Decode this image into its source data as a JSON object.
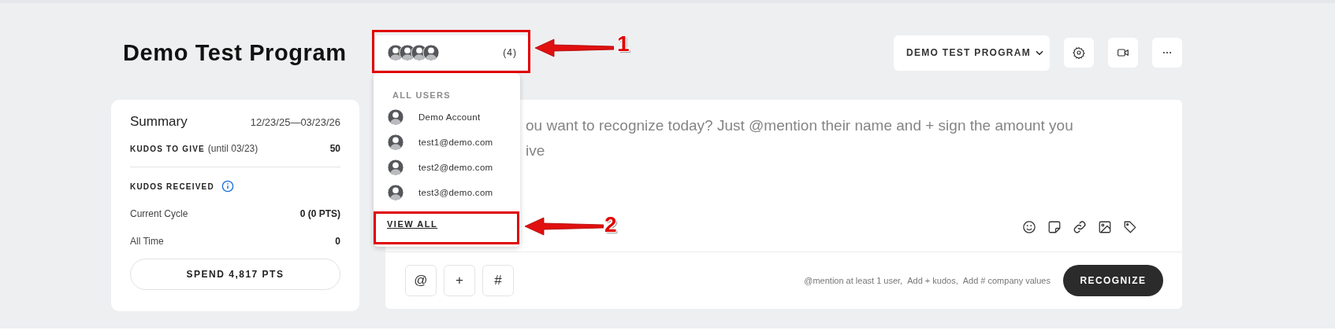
{
  "page_title": "Demo Test Program",
  "members_button": {
    "count": "(4)"
  },
  "program_select": {
    "label": "DEMO TEST PROGRAM"
  },
  "header_actions": [
    {
      "kind": "settings"
    },
    {
      "kind": "video"
    },
    {
      "kind": "more"
    }
  ],
  "summary": {
    "title": "Summary",
    "date_range": "12/23/25—03/23/26",
    "kudos_to_give": {
      "label": "KUDOS TO GIVE",
      "note": "(until 03/23)",
      "value": "50"
    },
    "kudos_received": {
      "label": "KUDOS RECEIVED",
      "rows": [
        {
          "label": "Current Cycle",
          "value": "0 (0 PTS)"
        },
        {
          "label": "All Time",
          "value": "0"
        }
      ]
    },
    "spend_button": "SPEND 4,817 PTS"
  },
  "composer": {
    "hint_lines": [
      "ou want to recognize today? Just @mention their name and + sign the amount you",
      "ive"
    ],
    "tools": [
      {
        "kind": "emoji"
      },
      {
        "kind": "sticker"
      },
      {
        "kind": "link"
      },
      {
        "kind": "image"
      },
      {
        "kind": "tag"
      }
    ],
    "insert_buttons": [
      "@",
      "+",
      "#"
    ],
    "hints": [
      "@mention at least 1 user,",
      "Add + kudos,",
      "Add # company values"
    ],
    "submit": "RECOGNIZE"
  },
  "users_menu": {
    "heading": "ALL USERS",
    "users": [
      {
        "name": "Demo Account"
      },
      {
        "name": "test1@demo.com"
      },
      {
        "name": "test2@demo.com"
      },
      {
        "name": "test3@demo.com"
      }
    ],
    "view_all": "VIEW ALL"
  },
  "annotations": [
    {
      "number": "1"
    },
    {
      "number": "2"
    }
  ]
}
